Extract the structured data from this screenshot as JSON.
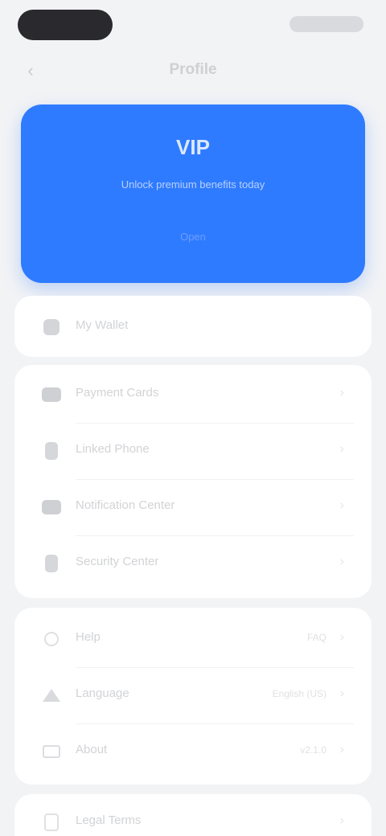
{
  "header": {
    "back_icon": "chevron-left-icon",
    "title": "Profile"
  },
  "banner": {
    "title": "VIP",
    "subtitle": "Unlock premium benefits today",
    "action": "Open",
    "color": "#2f7bff"
  },
  "card1": {
    "rows": [
      {
        "icon": "wallet-icon",
        "label": "My Wallet"
      }
    ]
  },
  "card2": {
    "rows": [
      {
        "icon": "card-icon",
        "label": "Payment Cards"
      },
      {
        "icon": "phone-icon",
        "label": "Linked Phone"
      },
      {
        "icon": "message-icon",
        "label": "Notification Center"
      },
      {
        "icon": "device-icon",
        "label": "Security Center"
      }
    ]
  },
  "card3": {
    "rows": [
      {
        "icon": "help-icon",
        "label": "Help",
        "value": "FAQ"
      },
      {
        "icon": "language-icon",
        "label": "Language",
        "value": "English (US)"
      },
      {
        "icon": "about-icon",
        "label": "About",
        "value": "v2.1.0"
      }
    ]
  },
  "card4": {
    "rows": [
      {
        "icon": "document-icon",
        "label": "Legal Terms"
      }
    ]
  },
  "colors": {
    "background": "#f2f3f5",
    "card": "#ffffff",
    "accent": "#2f7bff"
  }
}
